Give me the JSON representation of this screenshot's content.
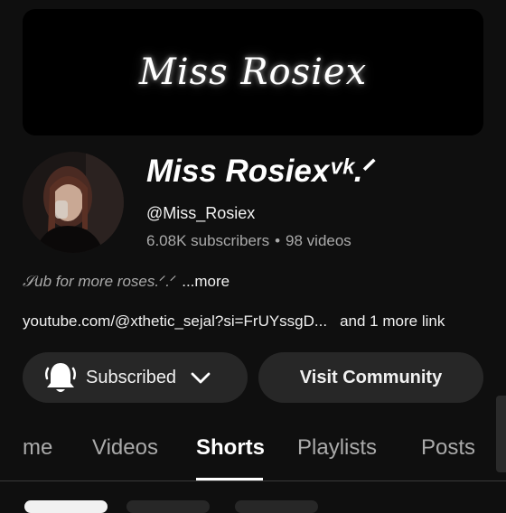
{
  "banner": {
    "text": "Miss Rosiex"
  },
  "channel": {
    "name": "Miss Rosiexᵛᵏ.ᐟ",
    "handle": "@Miss_Rosiex",
    "subscribers": "6.08K subscribers",
    "separator": "•",
    "videos": "98 videos"
  },
  "description": {
    "text": "𝒮ub for more roses.ᐟ.ᐟ",
    "more": "...more"
  },
  "links": {
    "primary": "youtube.com/@xthetic_sejal?si=FrUYssgD...",
    "more": "and 1 more link"
  },
  "buttons": {
    "subscribed": "Subscribed",
    "visit": "Visit Community"
  },
  "tabs": [
    "me",
    "Videos",
    "Shorts",
    "Playlists",
    "Posts"
  ],
  "active_tab": "Shorts",
  "icons": [
    "bell-icon",
    "chevron-down-icon"
  ],
  "colors": {
    "background": "#0f0f0f",
    "button": "#272727",
    "secondary_text": "#aaaaaa"
  }
}
